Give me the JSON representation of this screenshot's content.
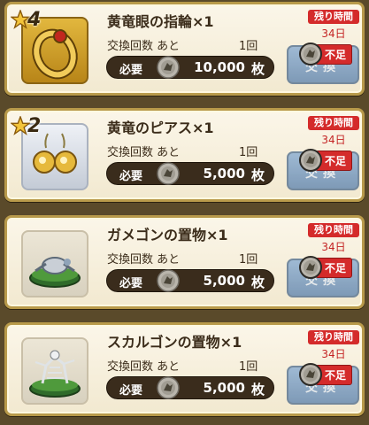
{
  "items": [
    {
      "stars": "4",
      "name": "黄竜眼の指輪×1",
      "exchange_label": "交換回数 あと",
      "exchange_count": "1回",
      "need_label": "必要",
      "price": "10,000",
      "unit": "枚",
      "remaining_label": "残り時間",
      "remaining_days": "34日",
      "button_label": "交換",
      "shortage_label": "不足",
      "thumb": "ring-icon"
    },
    {
      "stars": "2",
      "name": "黄竜のピアス×1",
      "exchange_label": "交換回数 あと",
      "exchange_count": "1回",
      "need_label": "必要",
      "price": "5,000",
      "unit": "枚",
      "remaining_label": "残り時間",
      "remaining_days": "34日",
      "button_label": "交換",
      "shortage_label": "不足",
      "thumb": "earring-icon"
    },
    {
      "stars": "",
      "name": "ガメゴンの置物×1",
      "exchange_label": "交換回数 あと",
      "exchange_count": "1回",
      "need_label": "必要",
      "price": "5,000",
      "unit": "枚",
      "remaining_label": "残り時間",
      "remaining_days": "34日",
      "button_label": "交換",
      "shortage_label": "不足",
      "thumb": "turtle-figure-icon"
    },
    {
      "stars": "",
      "name": "スカルゴンの置物×1",
      "exchange_label": "交換回数 あと",
      "exchange_count": "1回",
      "need_label": "必要",
      "price": "5,000",
      "unit": "枚",
      "remaining_label": "残り時間",
      "remaining_days": "34日",
      "button_label": "交換",
      "shortage_label": "不足",
      "thumb": "skeleton-dragon-figure-icon"
    }
  ],
  "colors": {
    "frame": "#b89a4a",
    "remaining_badge": "#d42b2b",
    "button": "#5a84b5"
  }
}
